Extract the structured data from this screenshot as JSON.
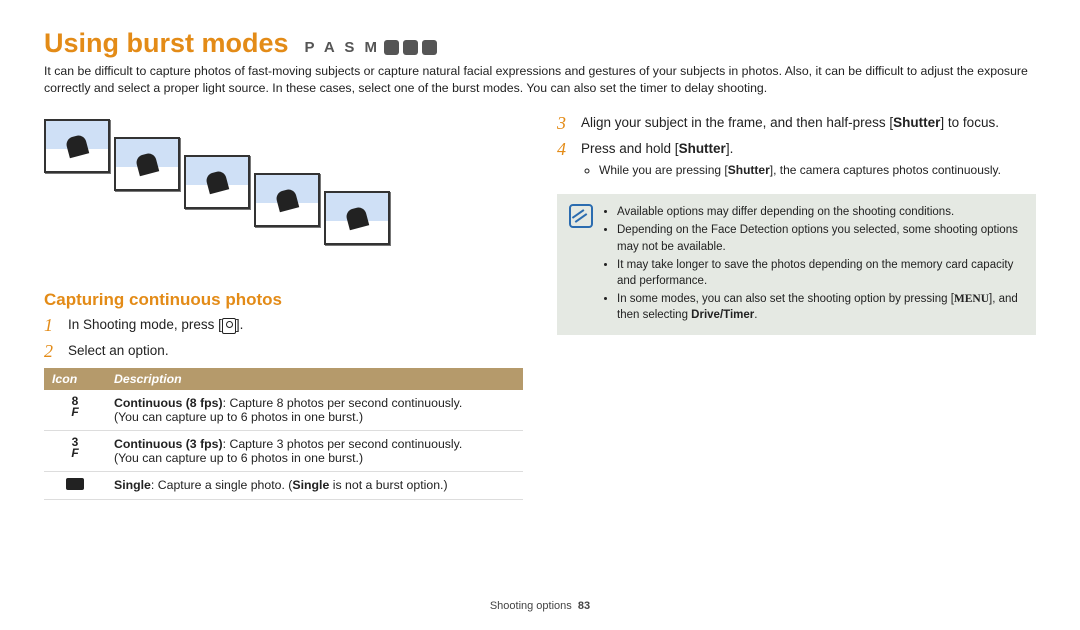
{
  "title": "Using burst modes",
  "mode_letters": "P A S M",
  "intro": "It can be difficult to capture photos of fast-moving subjects or capture natural facial expressions and gestures of your subjects in photos. Also, it can be difficult to adjust the exposure correctly and select a proper light source. In these cases, select one of the burst modes. You can also set the timer to delay shooting.",
  "subhead": "Capturing continuous photos",
  "left_steps": {
    "one_a": "In Shooting mode, press [",
    "one_b": "].",
    "two": "Select an option."
  },
  "table": {
    "head_icon": "Icon",
    "head_desc": "Description",
    "rows": [
      {
        "icon_top": "8",
        "icon_bot": "F",
        "title": "Continuous (8 fps)",
        "body": ": Capture 8 photos per second continuously.",
        "note": "(You can capture up to 6 photos in one burst.)"
      },
      {
        "icon_top": "3",
        "icon_bot": "F",
        "title": "Continuous (3 fps)",
        "body": ": Capture 3 photos per second continuously.",
        "note": "(You can capture up to 6 photos in one burst.)"
      },
      {
        "icon_top": "",
        "icon_bot": "",
        "title": "Single",
        "body": ": Capture a single photo. (",
        "title2": "Single",
        "body2": " is not a burst option.)",
        "note": ""
      }
    ]
  },
  "right_steps": {
    "three_a": "Align your subject in the frame, and then half-press [",
    "three_key": "Shutter",
    "three_b": "] to focus.",
    "four_a": "Press and hold [",
    "four_key": "Shutter",
    "four_b": "].",
    "four_sub_a": "While you are pressing [",
    "four_sub_key": "Shutter",
    "four_sub_b": "], the camera captures photos continuously."
  },
  "notes": [
    "Available options may differ depending on the shooting conditions.",
    "Depending on the Face Detection options you selected, some shooting options may not be available.",
    "It may take longer to save the photos depending on the memory card capacity and performance."
  ],
  "note4_a": "In some modes, you can also set the shooting option by pressing [",
  "note4_menu": "MENU",
  "note4_b": "], and then selecting ",
  "note4_bold": "Drive/Timer",
  "note4_c": ".",
  "footer_label": "Shooting options",
  "footer_page": "83"
}
